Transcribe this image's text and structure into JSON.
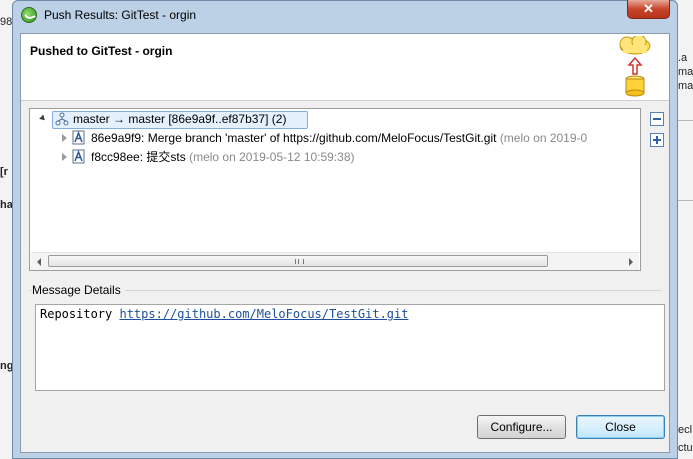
{
  "background": {
    "left_fragments": [
      "98",
      "[r",
      "ha",
      "ng"
    ],
    "right_fragments": [
      ".a",
      "ma",
      "ma",
      "ecl",
      "ctu"
    ]
  },
  "window": {
    "title": "Push Results: GitTest - orgin",
    "close_glyph": "✕"
  },
  "banner": {
    "heading": "Pushed to GitTest - orgin",
    "icon": "cloud-push-icon"
  },
  "tree": {
    "root": {
      "label": "master → master [86e9a9f..ef87b37] (2)",
      "icon": "branch-icon",
      "expanded": true
    },
    "children": [
      {
        "id": "86e9a9f9:",
        "message": "Merge branch 'master' of https://github.com/MeloFocus/TestGit.git",
        "meta": "(melo on 2019-0",
        "icon": "commit-icon"
      },
      {
        "id": "f8cc98ee:",
        "message": "提交sts",
        "meta": "(melo on 2019-05-12 10:59:38)",
        "icon": "commit-icon"
      }
    ],
    "scroll_grip": "|||"
  },
  "details": {
    "label": "Message Details",
    "prefix": "Repository",
    "link": "https://github.com/MeloFocus/TestGit.git"
  },
  "buttons": {
    "configure": "Configure...",
    "close": "Close"
  },
  "colors": {
    "selection": "#e4f0fc",
    "link": "#1e4f9c",
    "default_button": "#bee6fd"
  }
}
